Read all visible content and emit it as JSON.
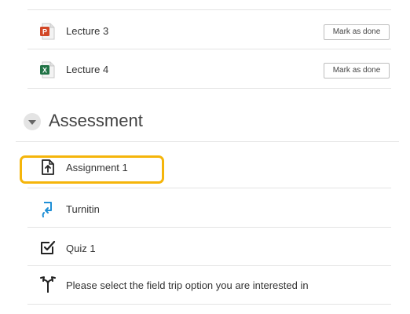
{
  "activities_top": [
    {
      "label": "Lecture 3",
      "icon": "powerpoint-file-icon",
      "button": "Mark as done"
    },
    {
      "label": "Lecture 4",
      "icon": "excel-file-icon",
      "button": "Mark as done"
    }
  ],
  "section": {
    "title": "Assessment",
    "toggle_icon": "collapse-chevron-icon"
  },
  "activities_assessment": [
    {
      "label": "Assignment 1",
      "icon": "assignment-upload-icon"
    },
    {
      "label": "Turnitin",
      "icon": "turnitin-icon"
    },
    {
      "label": "Quiz 1",
      "icon": "quiz-checkbox-icon"
    },
    {
      "label": "Please select the field trip option you are interested in",
      "icon": "choice-signpost-icon"
    }
  ],
  "colors": {
    "highlight": "#f5b50a",
    "powerpoint": "#d24726",
    "excel": "#217346",
    "turnitin": "#1f8fd6"
  }
}
